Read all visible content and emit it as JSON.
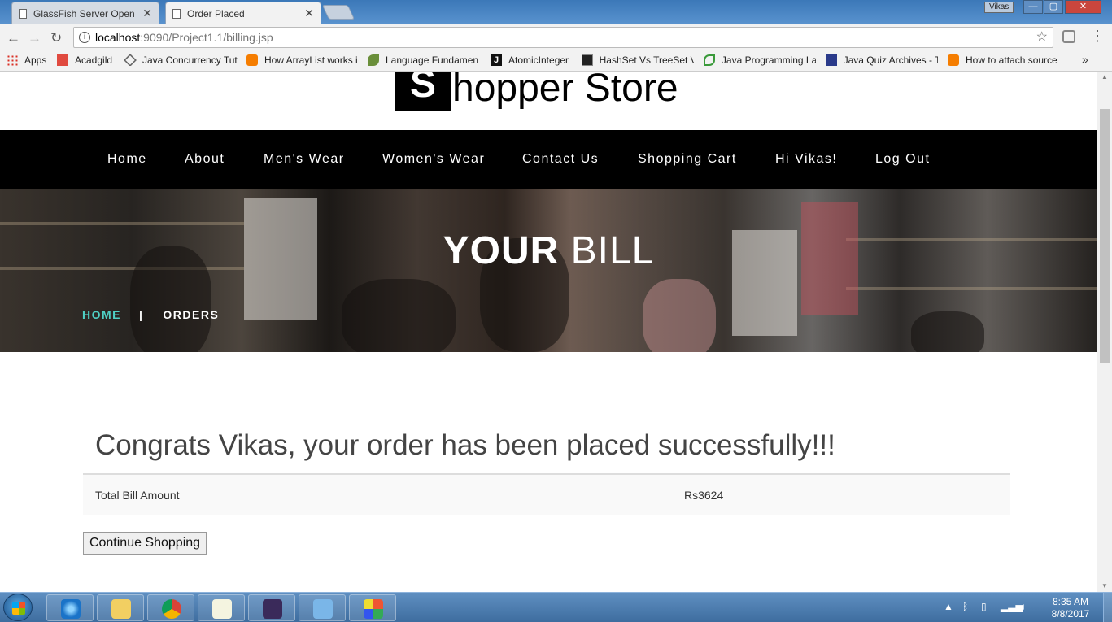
{
  "browser": {
    "tabs": [
      {
        "title": "GlassFish Server Open Source"
      },
      {
        "title": "Order Placed"
      }
    ],
    "window_user": "Vikas",
    "window_controls": {
      "minimize": "—",
      "maximize": "▢",
      "close": "✕"
    },
    "url_host": "localhost",
    "url_rest": ":9090/Project1.1/billing.jsp",
    "bookmarks": [
      {
        "label": "Apps",
        "icon": "apps-grid-icon",
        "color": "#d93025"
      },
      {
        "label": "Acadgild",
        "icon": "acadgild-icon",
        "color": "#e04a3f"
      },
      {
        "label": "Java Concurrency Tut",
        "icon": "diamond-icon",
        "color": "#666666"
      },
      {
        "label": "How ArrayList works i",
        "icon": "blogger-icon",
        "color": "#f57d00"
      },
      {
        "label": "Language Fundamen",
        "icon": "bird-icon",
        "color": "#6a8f3a"
      },
      {
        "label": "AtomicInteger",
        "icon": "j-icon",
        "color": "#111111"
      },
      {
        "label": "HashSet Vs TreeSet V",
        "icon": "terminal-icon",
        "color": "#222222"
      },
      {
        "label": "Java Programming La",
        "icon": "leaf-icon",
        "color": "#3a9a3a"
      },
      {
        "label": "Java Quiz Archives - T",
        "icon": "quiz-icon",
        "color": "#2a3a8a"
      },
      {
        "label": "How to attach source",
        "icon": "blogger-icon",
        "color": "#f57d00"
      }
    ],
    "bookmarks_more": "»"
  },
  "page": {
    "logo_letter": "S",
    "logo_text": "hopper Store",
    "nav": [
      "Home",
      "About",
      "Men's Wear",
      "Women's Wear",
      "Contact Us",
      "Shopping Cart",
      "Hi Vikas!",
      "Log Out"
    ],
    "banner_title_bold": "YOUR",
    "banner_title_rest": " BILL",
    "breadcrumb_home": "HOME",
    "breadcrumb_sep": "|",
    "breadcrumb_current": "ORDERS",
    "congrats": "Congrats Vikas, your order has been placed successfully!!!",
    "bill_label": "Total Bill Amount",
    "bill_value": "Rs3624",
    "continue_label": "Continue Shopping",
    "accent_color": "#4fd1c5"
  },
  "taskbar": {
    "apps": [
      "internet-explorer-icon",
      "file-explorer-icon",
      "chrome-icon",
      "notepad-icon",
      "java-ee-ide-icon",
      "media-player-icon",
      "paint-icon"
    ],
    "time": "8:35 AM",
    "date": "8/8/2017"
  }
}
